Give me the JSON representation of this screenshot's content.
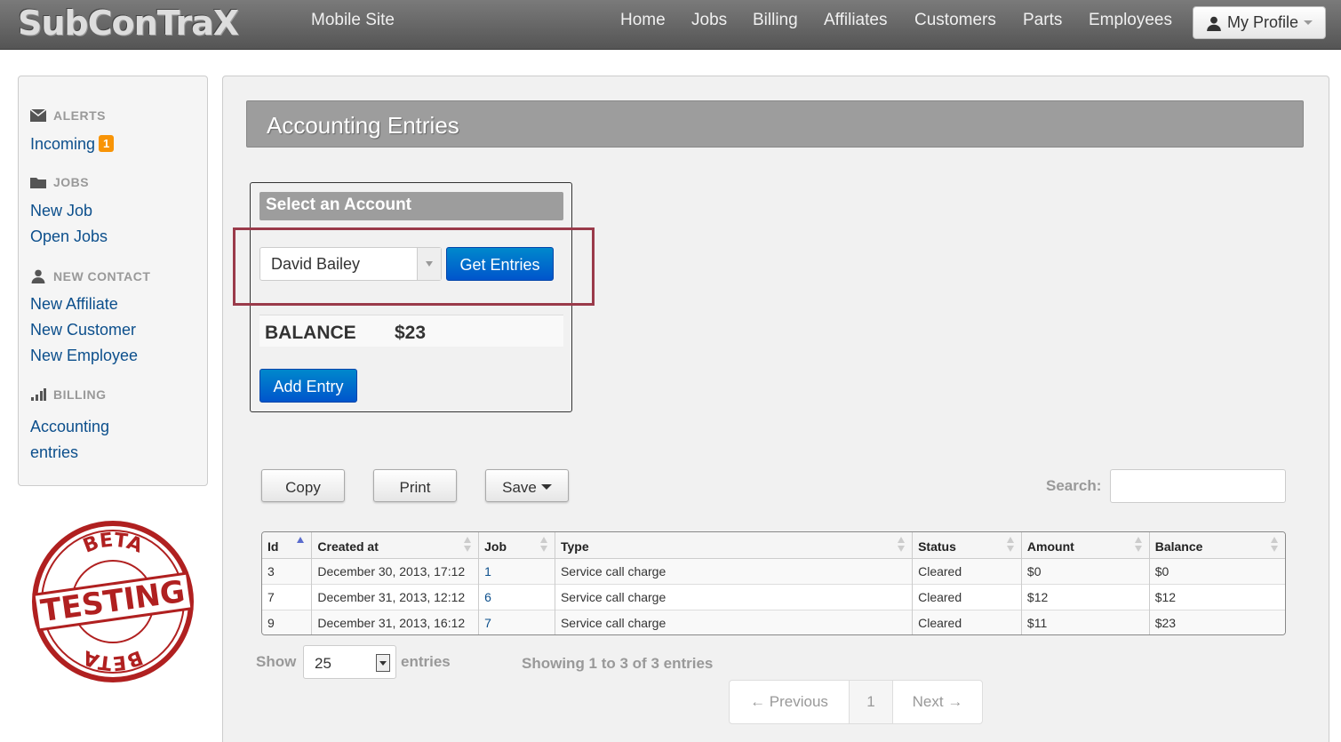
{
  "nav": {
    "brand": "SubConTraX",
    "mobile_site": "Mobile Site",
    "links": [
      "Home",
      "Jobs",
      "Billing",
      "Affiliates",
      "Customers",
      "Parts",
      "Employees"
    ],
    "profile": "My Profile"
  },
  "sidebar": {
    "alerts_header": "ALERTS",
    "incoming": "Incoming",
    "incoming_count": "1",
    "jobs_header": "JOBS",
    "new_job": "New Job",
    "open_jobs": "Open Jobs",
    "contact_header": "NEW CONTACT",
    "new_affiliate": "New Affiliate",
    "new_customer": "New Customer",
    "new_employee": "New Employee",
    "billing_header": "BILLING",
    "accounting_line1": "Accounting",
    "accounting_line2": "entries"
  },
  "stamp": {
    "top": "BETA",
    "middle": "TESTING",
    "bottom": "BETA"
  },
  "page": {
    "title": "Accounting Entries"
  },
  "account": {
    "title": "Select an Account",
    "selected": "David Bailey",
    "get_entries": "Get Entries",
    "balance_label": "BALANCE",
    "balance_value": "$23",
    "add_entry": "Add Entry"
  },
  "toolbar": {
    "copy": "Copy",
    "print": "Print",
    "save": "Save",
    "search_label": "Search:",
    "search_value": ""
  },
  "table": {
    "columns": [
      "Id",
      "Created at",
      "Job",
      "Type",
      "Status",
      "Amount",
      "Balance"
    ],
    "rows": [
      [
        "3",
        "December 30, 2013, 17:12",
        "1",
        "Service call charge",
        "Cleared",
        "$0",
        "$0"
      ],
      [
        "7",
        "December 31, 2013, 12:12",
        "6",
        "Service call charge",
        "Cleared",
        "$12",
        "$12"
      ],
      [
        "9",
        "December 31, 2013, 16:12",
        "7",
        "Service call charge",
        "Cleared",
        "$11",
        "$23"
      ]
    ]
  },
  "footer": {
    "show": "Show",
    "length": "25",
    "entries": "entries",
    "info": "Showing 1 to 3 of 3 entries",
    "previous": "← Previous",
    "page": "1",
    "next": "Next →"
  },
  "colors": {
    "link": "#0c4f8c",
    "primary": "#0066cc",
    "badge": "#f89406",
    "header_gray": "#9d9d9d",
    "stamp_red": "#b02020"
  }
}
